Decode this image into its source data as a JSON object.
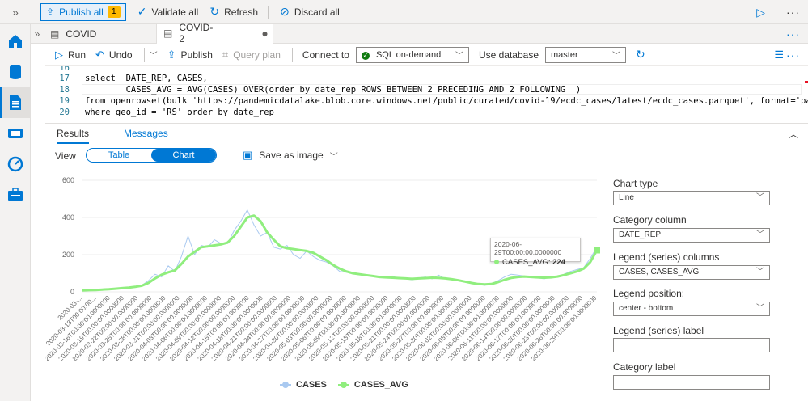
{
  "topbar": {
    "publish_all": "Publish all",
    "publish_count": "1",
    "validate_all": "Validate all",
    "refresh": "Refresh",
    "discard_all": "Discard all"
  },
  "tabs": [
    {
      "label": "COVID"
    },
    {
      "label": "COVID-2"
    }
  ],
  "query_toolbar": {
    "run": "Run",
    "undo": "Undo",
    "publish": "Publish",
    "query_plan": "Query plan",
    "connect_to_label": "Connect to",
    "connect_to_value": "SQL on-demand",
    "use_database_label": "Use database",
    "use_database_value": "master"
  },
  "editor": {
    "lines": [
      {
        "num": "16",
        "text": ""
      },
      {
        "num": "17",
        "text": "select  DATE_REP, CASES,"
      },
      {
        "num": "18",
        "text": "        CASES_AVG = AVG(CASES) OVER(order by date_rep ROWS BETWEEN 2 PRECEDING AND 2 FOLLOWING  )"
      },
      {
        "num": "19",
        "text": "from openrowset(bulk 'https://pandemicdatalake.blob.core.windows.net/public/curated/covid-19/ecdc_cases/latest/ecdc_cases.parquet', format='parquet') as a"
      },
      {
        "num": "20",
        "text": "where geo_id = 'RS' order by date_rep"
      }
    ]
  },
  "results": {
    "tab_results": "Results",
    "tab_messages": "Messages",
    "view_label": "View",
    "view_table": "Table",
    "view_chart": "Chart",
    "save_as_image": "Save as image"
  },
  "tooltip": {
    "date": "2020-06-29T00:00:00.0000000",
    "series": "CASES_AVG:",
    "value": "224"
  },
  "chart_data": {
    "type": "line",
    "ylim": [
      0,
      600
    ],
    "yticks": [
      0,
      200,
      400,
      600
    ],
    "x_tick_labels": [
      "2020-03-...",
      "2020-03-13T00:00:00...",
      "2020-03-16T00:00:00.0000000",
      "2020-03-19T00:00:00.0000000",
      "2020-03-22T00:00:00.0000000",
      "2020-03-25T00:00:00.0000000",
      "2020-03-28T00:00:00.0000000",
      "2020-03-31T00:00:00.0000000",
      "2020-04-03T00:00:00.0000000",
      "2020-04-06T00:00:00.0000000",
      "2020-04-09T00:00:00.0000000",
      "2020-04-12T00:00:00.0000000",
      "2020-04-15T00:00:00.0000000",
      "2020-04-18T00:00:00.0000000",
      "2020-04-21T00:00:00.0000000",
      "2020-04-24T00:00:00.0000000",
      "2020-04-27T00:00:00.0000000",
      "2020-04-30T00:00:00.0000000",
      "2020-05-03T00:00:00.0000000",
      "2020-05-06T00:00:00.0000000",
      "2020-05-09T00:00:00.0000000",
      "2020-05-12T00:00:00.0000000",
      "2020-05-15T00:00:00.0000000",
      "2020-05-18T00:00:00.0000000",
      "2020-05-21T00:00:00.0000000",
      "2020-05-24T00:00:00.0000000",
      "2020-05-27T00:00:00.0000000",
      "2020-05-30T00:00:00.0000000",
      "2020-06-02T00:00:00.0000000",
      "2020-06-05T00:00:00.0000000",
      "2020-06-08T00:00:00.0000000",
      "2020-06-11T00:00:00.0000000",
      "2020-06-14T00:00:00.0000000",
      "2020-06-17T00:00:00.0000000",
      "2020-06-20T00:00:00.0000000",
      "2020-06-23T00:00:00.0000000",
      "2020-06-26T00:00:00.0000000",
      "2020-06-29T00:00:00.0000000"
    ],
    "series": [
      {
        "name": "CASES",
        "color": "#a9c9f0",
        "values": [
          5,
          10,
          8,
          12,
          15,
          20,
          18,
          25,
          30,
          35,
          60,
          95,
          80,
          140,
          110,
          190,
          300,
          200,
          250,
          240,
          280,
          260,
          260,
          330,
          380,
          440,
          360,
          300,
          320,
          240,
          230,
          250,
          200,
          180,
          220,
          190,
          170,
          160,
          140,
          110,
          105,
          100,
          95,
          90,
          85,
          80,
          75,
          85,
          70,
          70,
          65,
          75,
          80,
          70,
          90,
          70,
          70,
          60,
          55,
          45,
          40,
          35,
          45,
          60,
          80,
          95,
          90,
          85,
          80,
          75,
          70,
          80,
          85,
          95,
          110,
          120,
          130,
          180,
          240
        ]
      },
      {
        "name": "CASES_AVG",
        "color": "#90ee7e",
        "values": [
          8,
          9,
          10,
          12,
          14,
          17,
          20,
          23,
          27,
          33,
          48,
          72,
          92,
          105,
          115,
          150,
          190,
          215,
          240,
          245,
          250,
          255,
          265,
          300,
          350,
          400,
          410,
          380,
          320,
          280,
          245,
          235,
          230,
          225,
          220,
          210,
          190,
          170,
          145,
          125,
          110,
          100,
          95,
          90,
          85,
          80,
          78,
          76,
          74,
          72,
          70,
          72,
          74,
          76,
          75,
          72,
          68,
          62,
          55,
          48,
          42,
          40,
          42,
          52,
          65,
          75,
          80,
          82,
          80,
          78,
          76,
          78,
          82,
          90,
          100,
          110,
          125,
          160,
          224
        ]
      }
    ],
    "legend_position": "center-bottom"
  },
  "panel": {
    "chart_type_label": "Chart type",
    "chart_type_value": "Line",
    "category_column_label": "Category column",
    "category_column_value": "DATE_REP",
    "legend_series_columns_label": "Legend (series) columns",
    "legend_series_columns_value": "CASES, CASES_AVG",
    "legend_position_label": "Legend position:",
    "legend_position_value": "center - bottom",
    "legend_series_label_label": "Legend (series) label",
    "legend_series_label_value": "",
    "category_label_label": "Category label",
    "category_label_value": ""
  },
  "colors": {
    "accent": "#0078d4",
    "avg_series": "#90ee7e",
    "cases_series": "#a9c9f0"
  }
}
